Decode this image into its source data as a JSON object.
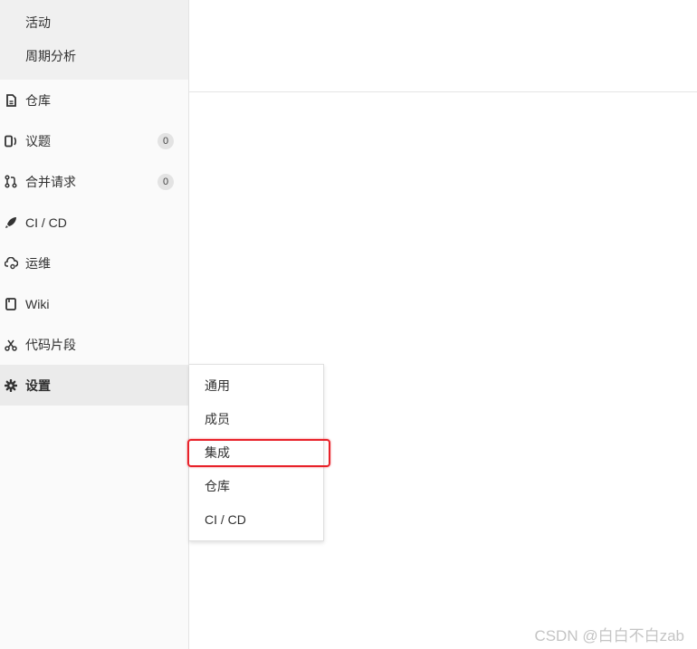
{
  "sidebar": {
    "subnav": [
      {
        "label": "活动"
      },
      {
        "label": "周期分析"
      }
    ],
    "items": [
      {
        "label": "仓库",
        "icon": "repository-icon"
      },
      {
        "label": "议题",
        "icon": "issues-icon",
        "count": "0"
      },
      {
        "label": "合并请求",
        "icon": "merge-request-icon",
        "count": "0"
      },
      {
        "label": "CI / CD",
        "icon": "rocket-icon"
      },
      {
        "label": "运维",
        "icon": "cloud-gear-icon"
      },
      {
        "label": "Wiki",
        "icon": "book-icon"
      },
      {
        "label": "代码片段",
        "icon": "scissors-icon"
      },
      {
        "label": "设置",
        "icon": "gear-icon"
      }
    ]
  },
  "flyout": {
    "items": [
      {
        "label": "通用"
      },
      {
        "label": "成员"
      },
      {
        "label": "集成"
      },
      {
        "label": "仓库"
      },
      {
        "label": "CI / CD"
      }
    ]
  },
  "watermark": "CSDN @白白不白zab",
  "colors": {
    "highlight": "#e8222a",
    "sidebar_bg": "#fafafa",
    "active_bg": "#ebebeb"
  }
}
